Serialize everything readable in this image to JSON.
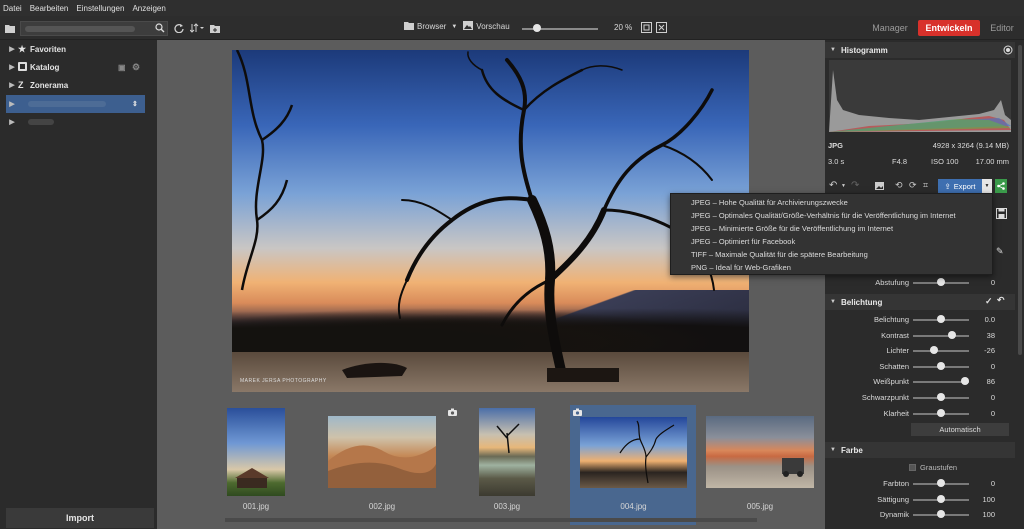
{
  "menu": [
    "Datei",
    "Bearbeiten",
    "Einstellungen",
    "Anzeigen"
  ],
  "toolbar": {
    "browser_label": "Browser",
    "preview_label": "Vorschau",
    "zoom": "20 %",
    "zoom_fraction": 0.2,
    "modes": [
      "Manager",
      "Entwickeln",
      "Editor"
    ],
    "active_mode": "Entwickeln",
    "active_color": "#d8312b"
  },
  "sidebar": {
    "items": [
      {
        "label": "Favoriten",
        "icon": "star-icon"
      },
      {
        "label": "Katalog",
        "icon": "catalog-icon"
      },
      {
        "label": "Zonerama",
        "icon": "zonerama-icon"
      }
    ],
    "import_label": "Import"
  },
  "thumbnails": [
    {
      "label": "001.jpg"
    },
    {
      "label": "002.jpg"
    },
    {
      "label": "003.jpg"
    },
    {
      "label": "004.jpg"
    },
    {
      "label": "005.jpg"
    }
  ],
  "export_menu": {
    "button_label": "Export",
    "options": [
      "JPEG – Hohe Qualität für Archivierungszwecke",
      "JPEG – Optimales Qualität/Größe-Verhältnis für die Veröffentlichung im Internet",
      "JPEG – Minimierte Größe für die Veröffentlichung im Internet",
      "JPEG – Optimiert für Facebook",
      "TIFF – Maximale Qualität für die spätere Bearbeitung",
      "PNG – Ideal für Web-Grafiken"
    ]
  },
  "histogram": {
    "title": "Histogramm",
    "format": "JPG",
    "dimensions": "4928 x 3264 (9.14 MB)",
    "shutter": "3.0 s",
    "aperture": "F4.8",
    "iso": "ISO 100",
    "focal": "17.00 mm"
  },
  "adjustments": {
    "abstufung": {
      "label": "Abstufung",
      "value": "0",
      "position": 0.5
    },
    "belichtung_title": "Belichtung",
    "belichtung": [
      {
        "label": "Belichtung",
        "value": "0.0",
        "position": 0.5
      },
      {
        "label": "Kontrast",
        "value": "38",
        "position": 0.69
      },
      {
        "label": "Lichter",
        "value": "-26",
        "position": 0.37
      },
      {
        "label": "Schatten",
        "value": "0",
        "position": 0.5
      },
      {
        "label": "Weißpunkt",
        "value": "86",
        "position": 0.93
      },
      {
        "label": "Schwarzpunkt",
        "value": "0",
        "position": 0.5
      },
      {
        "label": "Klarheit",
        "value": "0",
        "position": 0.5
      }
    ],
    "auto_label": "Automatisch",
    "farbe_title": "Farbe",
    "graustufen_label": "Graustufen",
    "farbe": [
      {
        "label": "Farbton",
        "value": "0",
        "position": 0.5
      },
      {
        "label": "Sättigung",
        "value": "100",
        "position": 0.5
      },
      {
        "label": "Dynamik",
        "value": "100",
        "position": 0.5
      }
    ]
  },
  "photo": {
    "watermark": "MAREK JERSA PHOTOGRAPHY"
  }
}
